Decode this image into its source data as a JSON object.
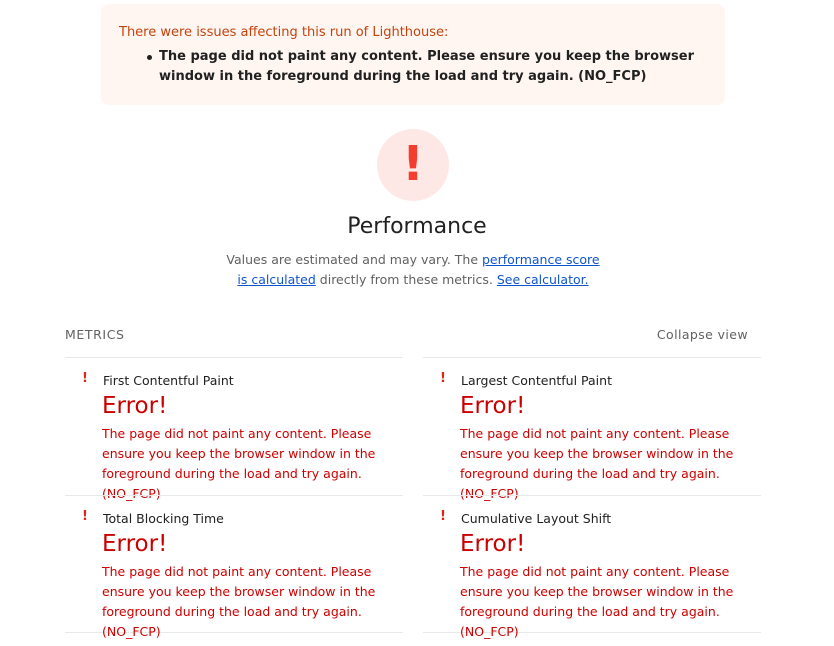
{
  "warning": {
    "title": "There were issues affecting this run of Lighthouse:",
    "items": [
      "The page did not paint any content. Please ensure you keep the browser window in the foreground during the load and try again. (NO_FCP)"
    ]
  },
  "gauge": {
    "symbol": "!",
    "title": "Performance",
    "description_prefix": "Values are estimated and may vary. The ",
    "description_link1": "performance score is calculated",
    "description_middle": " directly from these metrics. ",
    "description_link2": "See calculator.",
    "color": "#f33e2f"
  },
  "metrics": {
    "header": "METRICS",
    "collapse_label": "Collapse view",
    "items": [
      {
        "icon": "!",
        "name": "First Contentful Paint",
        "value": "Error!",
        "description": "The page did not paint any content. Please ensure you keep the browser window in the foreground during the load and try again. (NO_FCP)"
      },
      {
        "icon": "!",
        "name": "Largest Contentful Paint",
        "value": "Error!",
        "description": "The page did not paint any content. Please ensure you keep the browser window in the foreground during the load and try again. (NO_FCP)"
      },
      {
        "icon": "!",
        "name": "Total Blocking Time",
        "value": "Error!",
        "description": "The page did not paint any content. Please ensure you keep the browser window in the foreground during the load and try again. (NO_FCP)"
      },
      {
        "icon": "!",
        "name": "Cumulative Layout Shift",
        "value": "Error!",
        "description": "The page did not paint any content. Please ensure you keep the browser window in the foreground during the load and try again. (NO_FCP)"
      }
    ]
  }
}
